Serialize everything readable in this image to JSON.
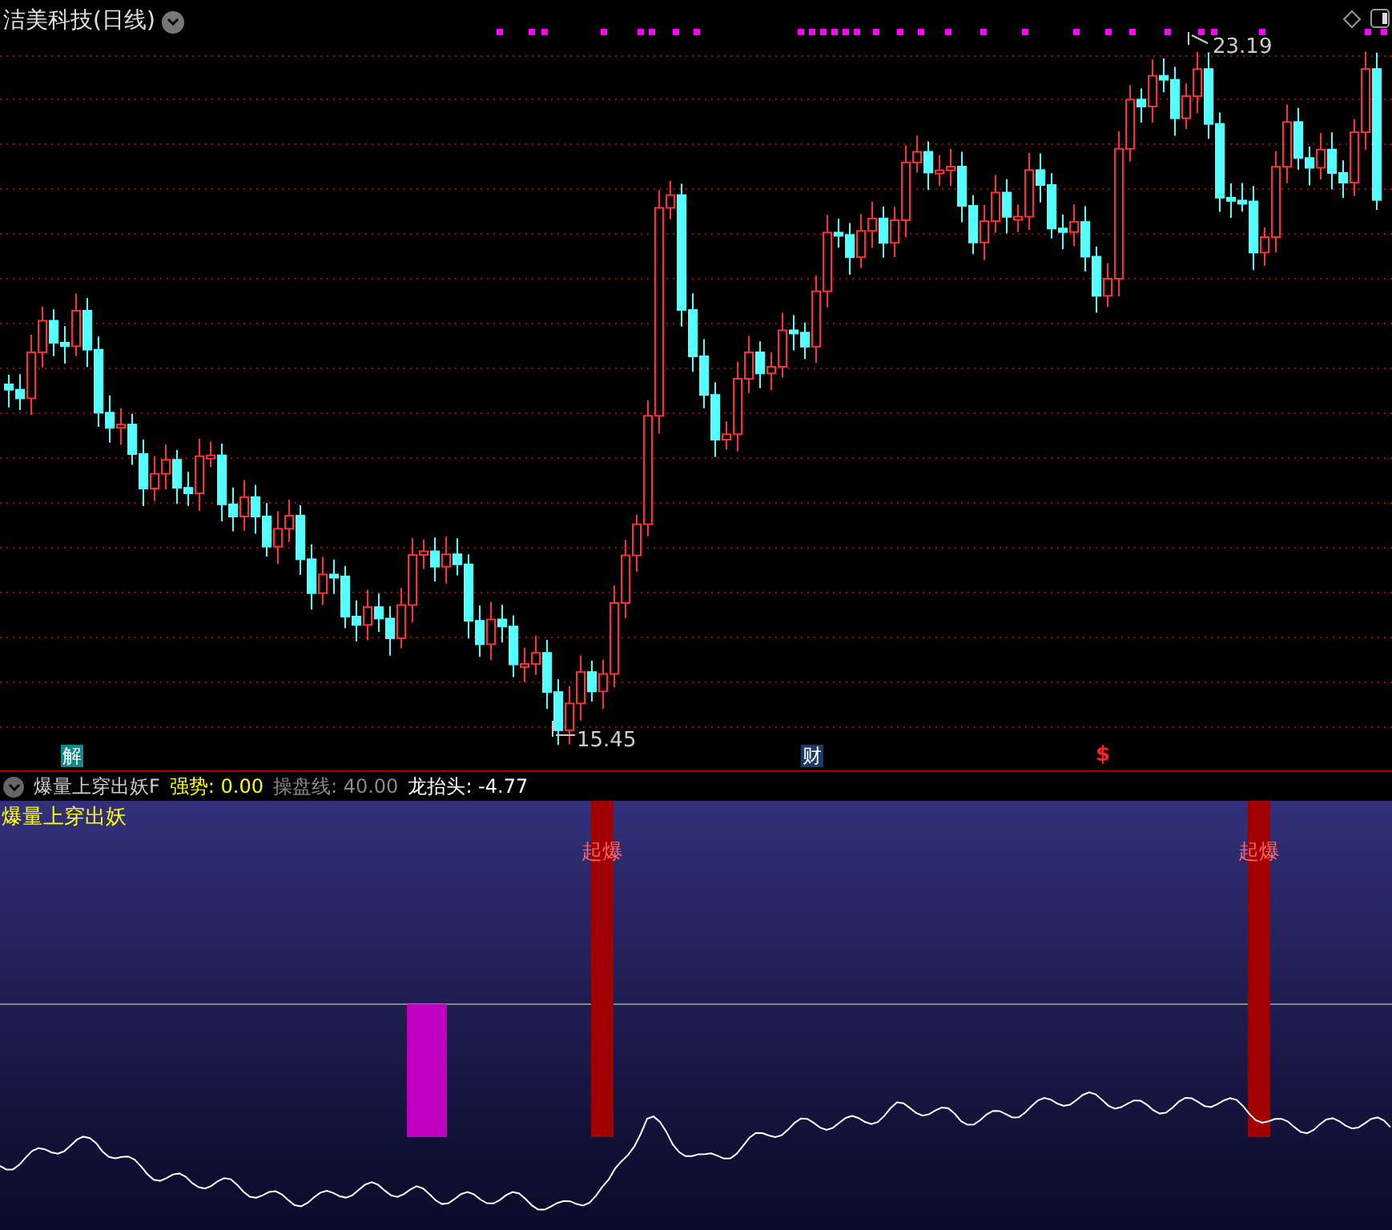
{
  "chart": {
    "title": "洁美科技(日线)",
    "high_label": "23.19",
    "low_label": "15.45",
    "events": [
      {
        "kind": "badge",
        "text": "解",
        "color": "#0f8a8a"
      },
      {
        "kind": "badge",
        "text": "财",
        "color": "#1a3a6a"
      },
      {
        "kind": "mark",
        "text": "$",
        "color": "#ff2020"
      }
    ]
  },
  "indicator": {
    "name": "爆量上穿出妖F",
    "legend": [
      {
        "label": "强势: 0.00",
        "kind": "strength"
      },
      {
        "label": "操盘线: 40.00",
        "kind": "line"
      },
      {
        "label": "龙抬头: -4.77",
        "kind": "value"
      }
    ],
    "panel_label": "爆量上穿出妖",
    "signals": [
      {
        "label": "起爆"
      },
      {
        "label": "起爆"
      }
    ]
  }
}
